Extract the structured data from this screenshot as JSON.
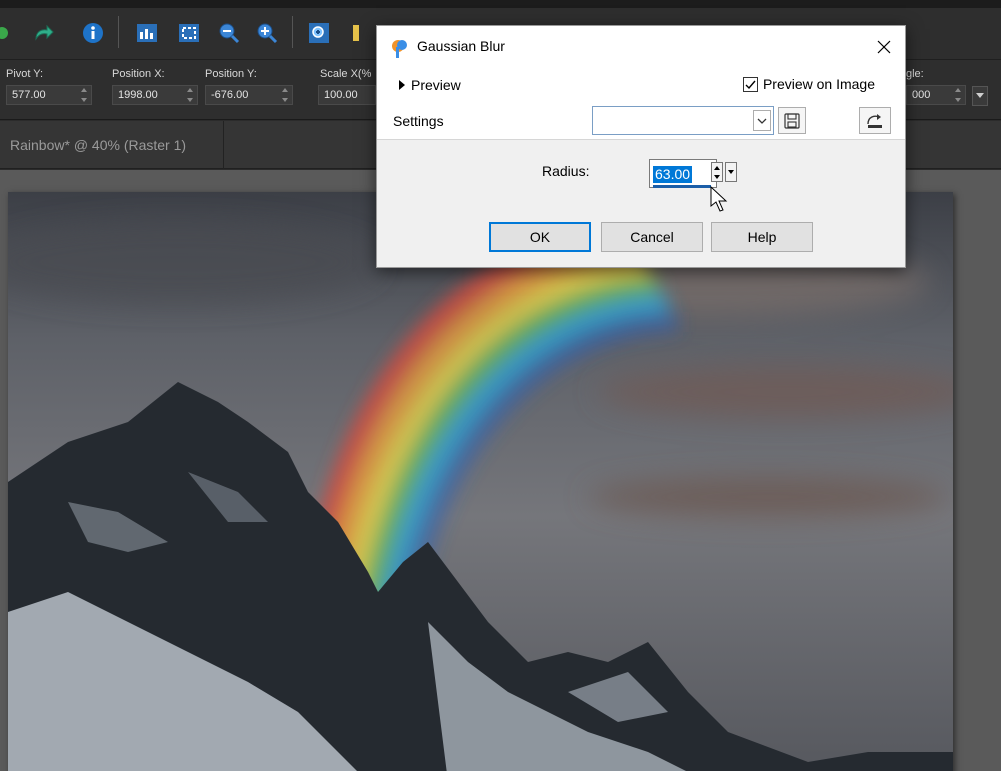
{
  "toolbar": {
    "icons": [
      "redo-icon",
      "info-icon",
      "histogram-icon",
      "fit-window-icon",
      "zoom-out-icon",
      "zoom-in-icon",
      "zoom-selection-icon"
    ]
  },
  "property_bar": {
    "pivot_y": {
      "label": "Pivot Y:",
      "value": "577.00"
    },
    "position_x": {
      "label": "Position X:",
      "value": "1998.00"
    },
    "position_y": {
      "label": "Position Y:",
      "value": "-676.00"
    },
    "scale_x": {
      "label": "Scale X(%",
      "value": "100.00"
    },
    "angle": {
      "label": "gle:",
      "value": "000"
    }
  },
  "document_tab": {
    "label": "Rainbow* @  40% (Raster 1)"
  },
  "dialog": {
    "title": "Gaussian Blur",
    "preview_label": "Preview",
    "preview_on_image_label": "Preview on Image",
    "preview_on_image_checked": true,
    "settings_label": "Settings",
    "settings_value": "",
    "radius_label": "Radius:",
    "radius_value": "63.00",
    "ok_label": "OK",
    "cancel_label": "Cancel",
    "help_label": "Help"
  },
  "colors": {
    "accent": "#0078d7",
    "dialog_bg": "#f0f0f0",
    "app_bg": "#2e2e2e"
  }
}
